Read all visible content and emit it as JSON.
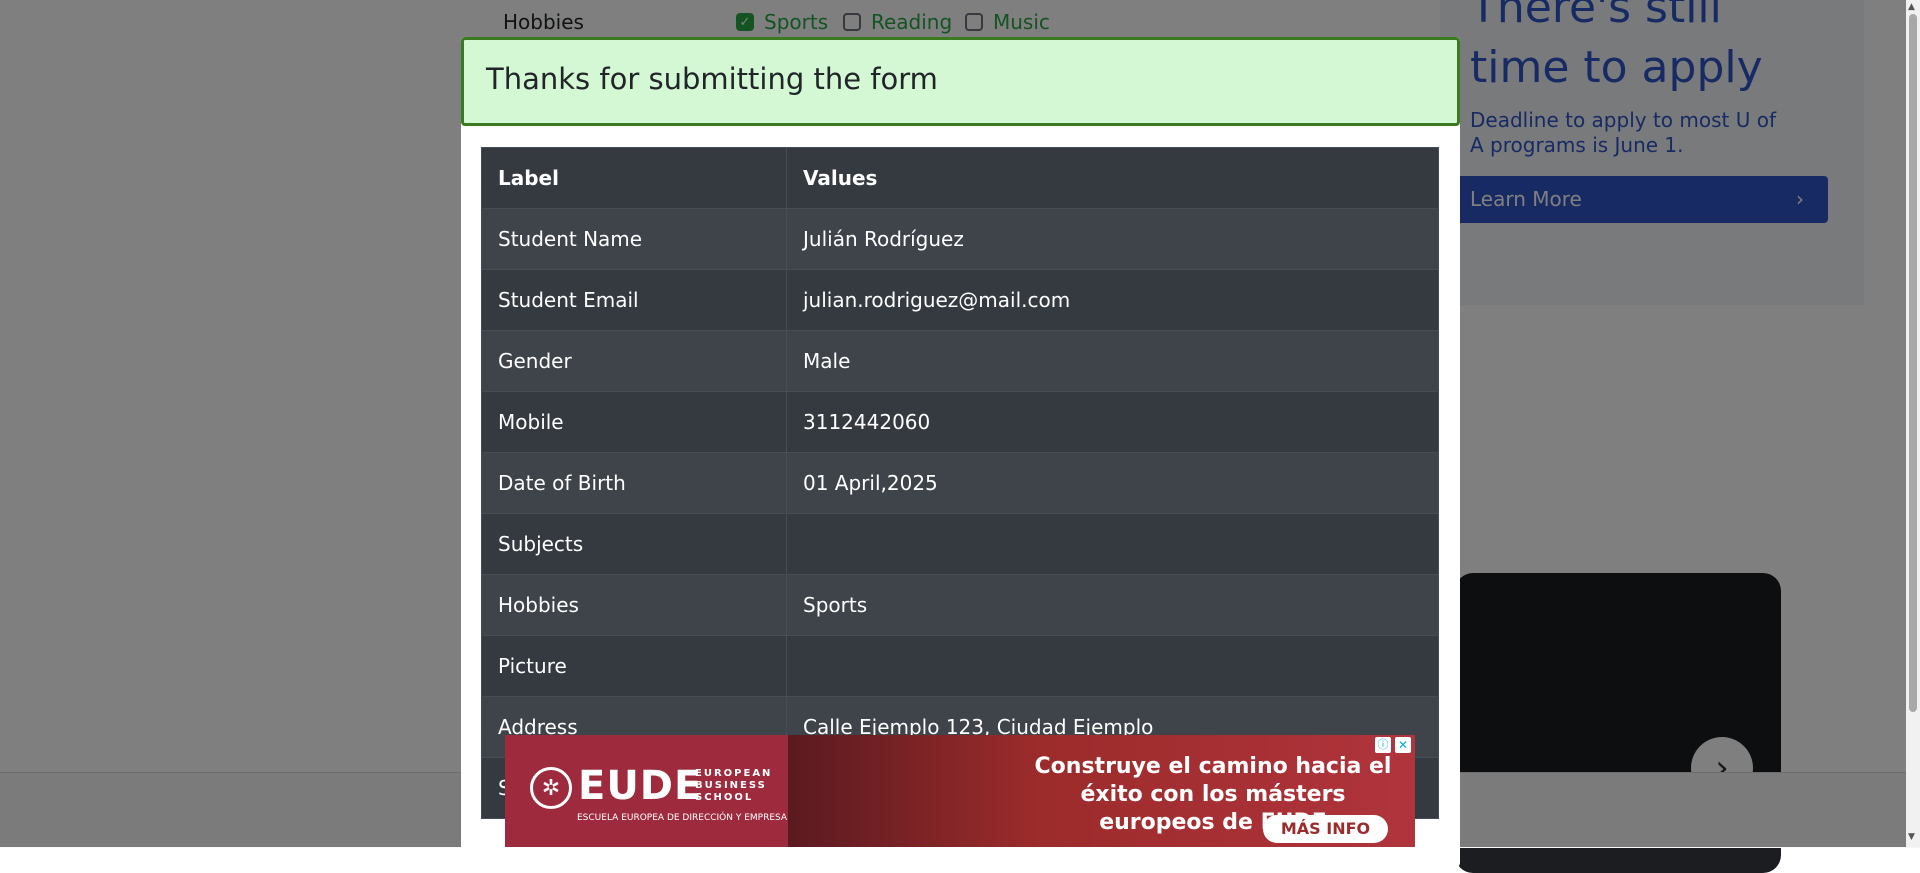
{
  "background": {
    "hobbies_label": "Hobbies",
    "hobbies": [
      {
        "label": "Sports",
        "checked": true
      },
      {
        "label": "Reading",
        "checked": false
      },
      {
        "label": "Music",
        "checked": false
      }
    ],
    "side_ad": {
      "title": "There's still time to apply",
      "subtitle": "Deadline to apply to most U of A programs is June 1.",
      "button_label": "Learn More"
    }
  },
  "modal": {
    "title": "Thanks for submitting the form",
    "table": {
      "headers": [
        "Label",
        "Values"
      ],
      "rows": [
        {
          "label": "Student Name",
          "value": "Julián Rodríguez"
        },
        {
          "label": "Student Email",
          "value": "julian.rodriguez@mail.com"
        },
        {
          "label": "Gender",
          "value": "Male"
        },
        {
          "label": "Mobile",
          "value": "3112442060"
        },
        {
          "label": "Date of Birth",
          "value": "01 April,2025"
        },
        {
          "label": "Subjects",
          "value": ""
        },
        {
          "label": "Hobbies",
          "value": "Sports"
        },
        {
          "label": "Picture",
          "value": ""
        },
        {
          "label": "Address",
          "value": "Calle Ejemplo 123, Ciudad Ejemplo"
        },
        {
          "label": "S",
          "value": ""
        }
      ]
    }
  },
  "bottom_ad": {
    "logo_word": "EUDE",
    "logo_side": "EUROPEAN BUSINESS SCHOOL",
    "logo_sub": "ESCUELA EUROPEA DE DIRECCIÓN Y EMPRESA",
    "headline": "Construye el camino hacia el éxito con los másters europeos de EUDE",
    "cta_label": "MÁS INFO"
  },
  "colors": {
    "header_bg": "#d4f8d4",
    "header_border": "#3c7a22",
    "table_dark": "#343a40",
    "ad_blue": "#2e55c6"
  }
}
